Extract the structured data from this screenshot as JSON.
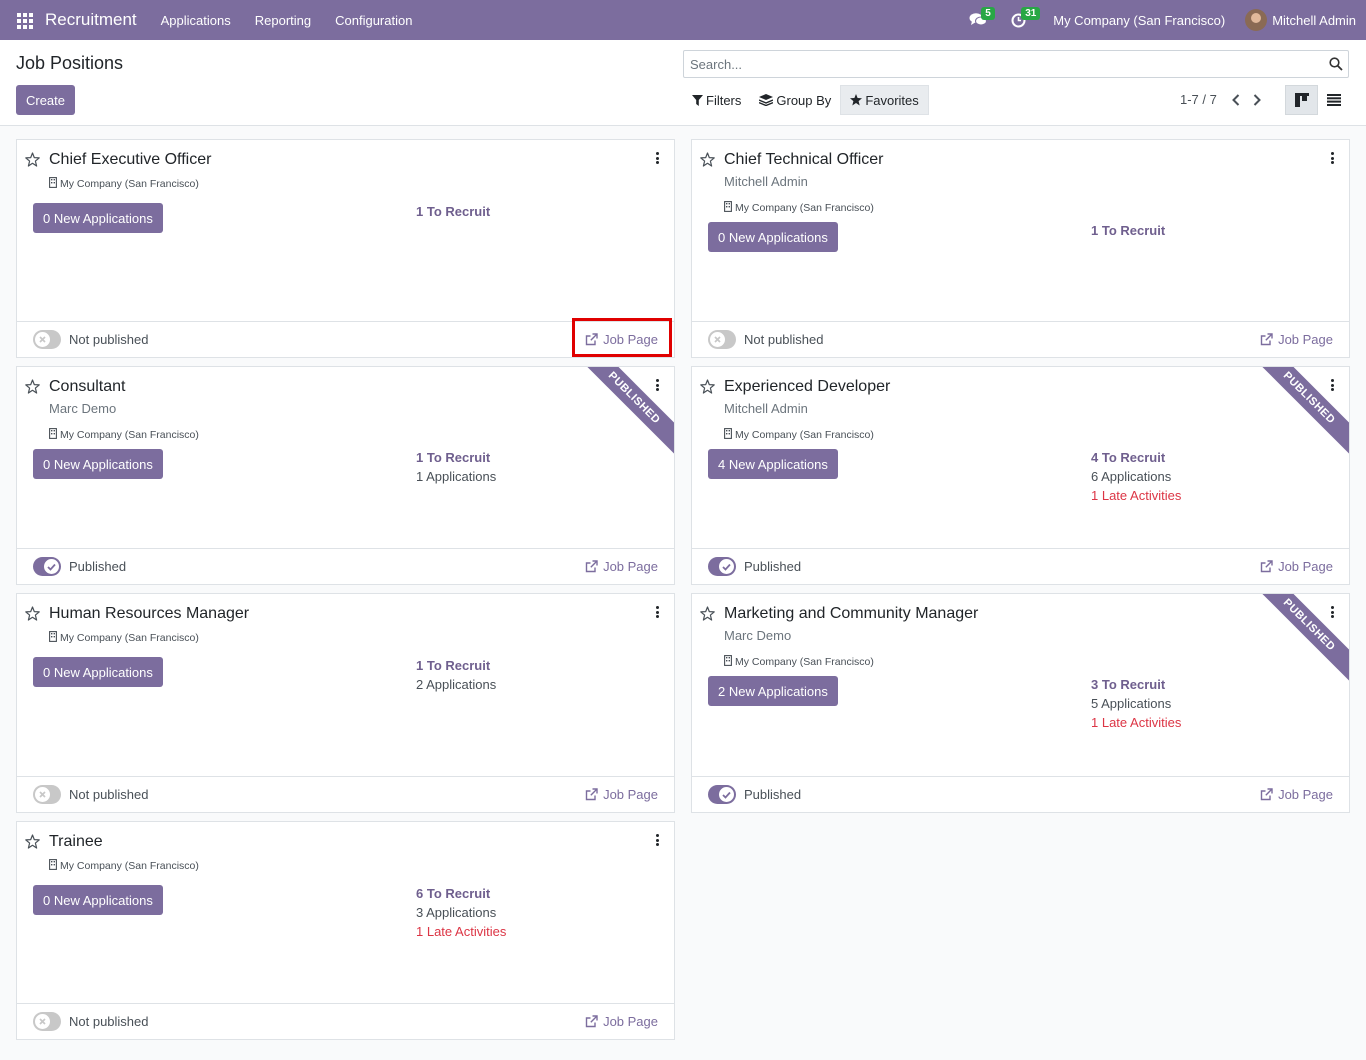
{
  "navbar": {
    "app_name": "Recruitment",
    "menus": [
      "Applications",
      "Reporting",
      "Configuration"
    ],
    "messages_count": "5",
    "activities_count": "31",
    "company": "My Company (San Francisco)",
    "user": "Mitchell Admin",
    "accent_color": "#7c6d9e"
  },
  "control_panel": {
    "title": "Job Positions",
    "create_label": "Create",
    "search_placeholder": "Search...",
    "filters_label": "Filters",
    "groupby_label": "Group By",
    "favorites_label": "Favorites",
    "pager": "1-7 / 7"
  },
  "jobs": [
    {
      "title": "Chief Executive Officer",
      "recruiter": "",
      "company": "My Company (San Francisco)",
      "new_apps": "0 New Applications",
      "to_recruit": "1 To Recruit",
      "applications": "",
      "late": "",
      "published": false,
      "pub_label": "Not published",
      "job_page": "Job Page"
    },
    {
      "title": "Chief Technical Officer",
      "recruiter": "Mitchell Admin",
      "company": "My Company (San Francisco)",
      "new_apps": "0 New Applications",
      "to_recruit": "1 To Recruit",
      "applications": "",
      "late": "",
      "published": false,
      "pub_label": "Not published",
      "job_page": "Job Page"
    },
    {
      "title": "Consultant",
      "recruiter": "Marc Demo",
      "company": "My Company (San Francisco)",
      "new_apps": "0 New Applications",
      "to_recruit": "1 To Recruit",
      "applications": "1 Applications",
      "late": "",
      "published": true,
      "ribbon": "PUBLISHED",
      "pub_label": "Published",
      "job_page": "Job Page"
    },
    {
      "title": "Experienced Developer",
      "recruiter": "Mitchell Admin",
      "company": "My Company (San Francisco)",
      "new_apps": "4 New Applications",
      "to_recruit": "4 To Recruit",
      "applications": "6 Applications",
      "late": "1 Late Activities",
      "published": true,
      "ribbon": "PUBLISHED",
      "pub_label": "Published",
      "job_page": "Job Page"
    },
    {
      "title": "Human Resources Manager",
      "recruiter": "",
      "company": "My Company (San Francisco)",
      "new_apps": "0 New Applications",
      "to_recruit": "1 To Recruit",
      "applications": "2 Applications",
      "late": "",
      "published": false,
      "pub_label": "Not published",
      "job_page": "Job Page"
    },
    {
      "title": "Marketing and Community Manager",
      "recruiter": "Marc Demo",
      "company": "My Company (San Francisco)",
      "new_apps": "2 New Applications",
      "to_recruit": "3 To Recruit",
      "applications": "5 Applications",
      "late": "1 Late Activities",
      "published": true,
      "ribbon": "PUBLISHED",
      "pub_label": "Published",
      "job_page": "Job Page"
    },
    {
      "title": "Trainee",
      "recruiter": "",
      "company": "My Company (San Francisco)",
      "new_apps": "0 New Applications",
      "to_recruit": "6 To Recruit",
      "applications": "3 Applications",
      "late": "1 Late Activities",
      "published": false,
      "pub_label": "Not published",
      "job_page": "Job Page"
    }
  ]
}
